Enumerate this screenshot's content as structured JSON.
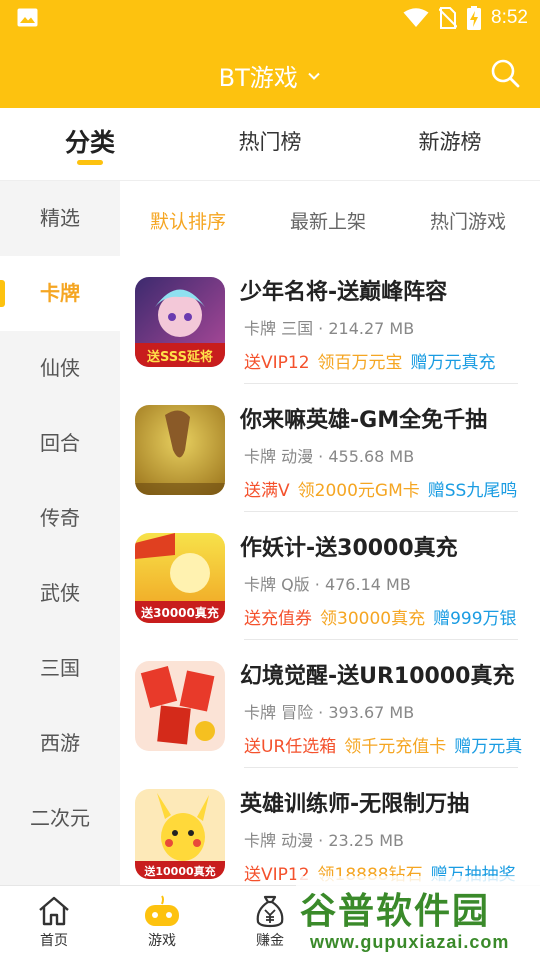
{
  "status_bar": {
    "time": "8:52"
  },
  "header": {
    "title": "BT游戏"
  },
  "top_tabs": [
    {
      "label": "分类",
      "active": true
    },
    {
      "label": "热门榜",
      "active": false
    },
    {
      "label": "新游榜",
      "active": false
    }
  ],
  "sidebar": {
    "items": [
      {
        "label": "精选",
        "active": false
      },
      {
        "label": "卡牌",
        "active": true
      },
      {
        "label": "仙侠",
        "active": false
      },
      {
        "label": "回合",
        "active": false
      },
      {
        "label": "传奇",
        "active": false
      },
      {
        "label": "武侠",
        "active": false
      },
      {
        "label": "三国",
        "active": false
      },
      {
        "label": "西游",
        "active": false
      },
      {
        "label": "二次元",
        "active": false
      }
    ]
  },
  "sort_tabs": [
    {
      "label": "默认排序",
      "active": true
    },
    {
      "label": "最新上架",
      "active": false
    },
    {
      "label": "热门游戏",
      "active": false
    }
  ],
  "games": [
    {
      "title": "少年名将-送巅峰阵容",
      "meta": "卡牌 三国 · 214.27 MB",
      "tags": [
        "送VIP12",
        "领百万元宝",
        "赠万元真充"
      ],
      "thumb_text": "送SSS延将"
    },
    {
      "title": "你来嘛英雄-GM全免千抽",
      "meta": "卡牌 动漫 · 455.68 MB",
      "tags": [
        "送满V",
        "领2000元GM卡",
        "赠SS九尾鸣"
      ],
      "thumb_text": ""
    },
    {
      "title": "作妖计-送30000真充",
      "meta": "卡牌 Q版 · 476.14 MB",
      "tags": [
        "送充值券",
        "领30000真充",
        "赠999万银"
      ],
      "thumb_text": "送30000真充"
    },
    {
      "title": "幻境觉醒-送UR10000真充",
      "meta": "卡牌 冒险 · 393.67 MB",
      "tags": [
        "送UR任选箱",
        "领千元充值卡",
        "赠万元真"
      ],
      "thumb_text": ""
    },
    {
      "title": "英雄训练师-无限制万抽",
      "meta": "卡牌 动漫 · 23.25 MB",
      "tags": [
        "送VIP12",
        "领18888钻石",
        "赠万抽抽奖"
      ],
      "thumb_text": "送10000真充"
    }
  ],
  "bottom_nav": [
    {
      "label": "首页",
      "icon": "home-icon",
      "active": false
    },
    {
      "label": "游戏",
      "icon": "gamepad-icon",
      "active": true
    },
    {
      "label": "赚金",
      "icon": "money-bag-icon",
      "active": false
    }
  ],
  "watermark": {
    "text": "谷普软件园",
    "url": "www.gupuxiazai.com"
  },
  "colors": {
    "brand_yellow": "#fdc20f",
    "active_orange": "#f5a623",
    "tag_red": "#f4512c",
    "tag_blue": "#1a9ce2"
  }
}
